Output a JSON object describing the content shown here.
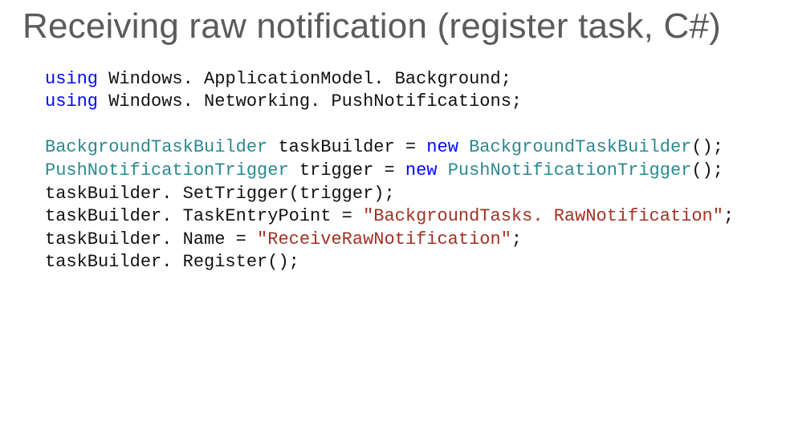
{
  "slide": {
    "title": "Receiving raw notification (register task, C#)"
  },
  "code": {
    "kw_using": "using",
    "kw_new": "new",
    "ns1": " Windows. ApplicationModel. Background;",
    "ns2": " Windows. Networking. PushNotifications;",
    "t_btb": "BackgroundTaskBuilder",
    "decl_btb_mid": " taskBuilder = ",
    "ctor_btb_end": "();",
    "t_pnt": "PushNotificationTrigger",
    "decl_pnt_mid": " trigger = ",
    "ctor_pnt_end": "();",
    "l_settrigger": "taskBuilder. SetTrigger(trigger);",
    "l_entry_lhs": "taskBuilder. TaskEntryPoint = ",
    "s_entry": "\"BackgroundTasks. RawNotification\"",
    "semi": ";",
    "l_name_lhs": "taskBuilder. Name = ",
    "s_name": "\"ReceiveRawNotification\"",
    "l_register": "taskBuilder. Register();"
  }
}
